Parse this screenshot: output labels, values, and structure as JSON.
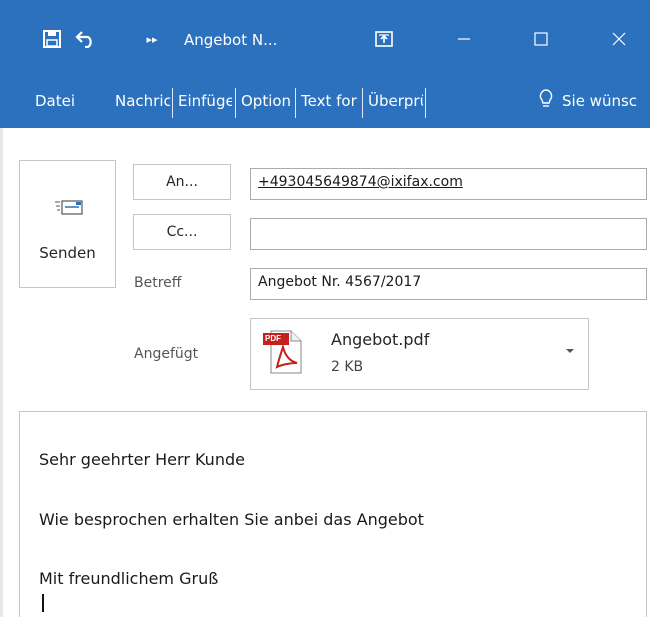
{
  "window": {
    "title": "Angebot N...",
    "controls": [
      "minimize",
      "maximize",
      "close"
    ]
  },
  "quick_access": {
    "icons": [
      "save-icon",
      "undo-icon",
      "more-commands-icon",
      "popout-icon"
    ]
  },
  "ribbon": {
    "tabs": [
      "Datei",
      "Nachric",
      "Einfüge",
      "Option",
      "Text for",
      "Überprü"
    ],
    "tell_me": "Sie wünsc"
  },
  "compose": {
    "send_label": "Senden",
    "to_button": "An...",
    "cc_button": "Cc...",
    "to_value": "+493045649874@ixifax.com",
    "cc_value": "",
    "subject_label": "Betreff",
    "subject_value": "Angebot Nr. 4567/2017",
    "attached_label": "Angefügt",
    "attachment": {
      "name": "Angebot.pdf",
      "size": "2 KB",
      "badge": "PDF"
    }
  },
  "message": {
    "lines": [
      "Sehr geehrter Herr Kunde",
      "Wie besprochen erhalten Sie anbei das Angebot",
      "Mit freundlichem Gruß"
    ]
  },
  "colors": {
    "titlebar": "#2b71bd",
    "pdf_red": "#c6201c"
  }
}
